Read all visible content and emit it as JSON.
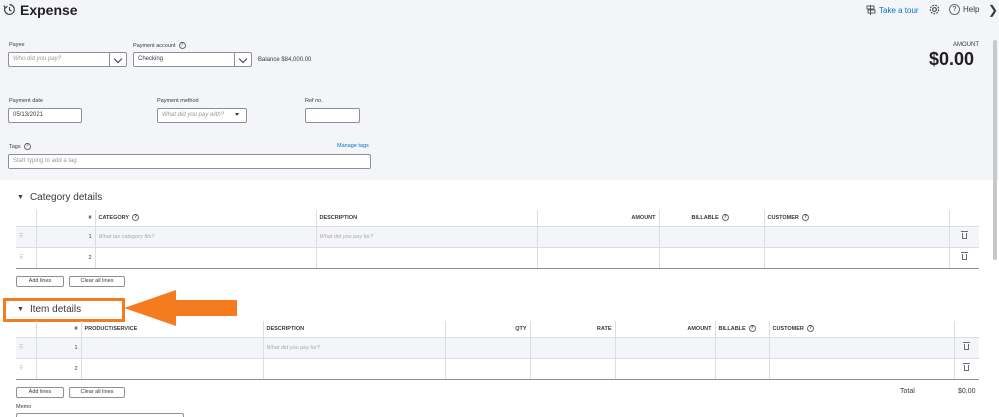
{
  "header": {
    "title": "Expense",
    "take_tour": "Take a tour",
    "help": "Help",
    "amount_label": "AMOUNT",
    "amount_value": "$0.00"
  },
  "form": {
    "payee_label": "Payee",
    "payee_placeholder": "Who did you pay?",
    "payment_account_label": "Payment account",
    "payment_account_value": "Checking",
    "balance": "Balance $84,000.00",
    "payment_date_label": "Payment date",
    "payment_date_value": "05/13/2021",
    "payment_method_label": "Payment method",
    "payment_method_placeholder": "What did you pay with?",
    "ref_no_label": "Ref no.",
    "tags_label": "Tags",
    "manage_tags": "Manage tags",
    "tags_placeholder": "Start typing to add a tag"
  },
  "category": {
    "title": "Category details",
    "columns": [
      "#",
      "CATEGORY",
      "DESCRIPTION",
      "AMOUNT",
      "BILLABLE",
      "CUSTOMER"
    ],
    "row1_num": "1",
    "row1_category_placeholder": "What tax category fits?",
    "row1_description_placeholder": "What did you pay for?",
    "row2_num": "2",
    "add_lines": "Add lines",
    "clear_lines": "Clear all lines"
  },
  "items": {
    "title": "Item details",
    "columns": [
      "#",
      "PRODUCT/SERVICE",
      "DESCRIPTION",
      "QTY",
      "RATE",
      "AMOUNT",
      "BILLABLE",
      "CUSTOMER"
    ],
    "row1_num": "1",
    "row1_description_placeholder": "What did you pay for?",
    "row2_num": "2",
    "add_lines": "Add lines",
    "clear_lines": "Clear all lines"
  },
  "footer": {
    "total_label": "Total",
    "total_value": "$0.00",
    "memo_label": "Memo"
  },
  "colors": {
    "accent_link": "#0077c5",
    "highlight_orange": "#f47b20"
  }
}
